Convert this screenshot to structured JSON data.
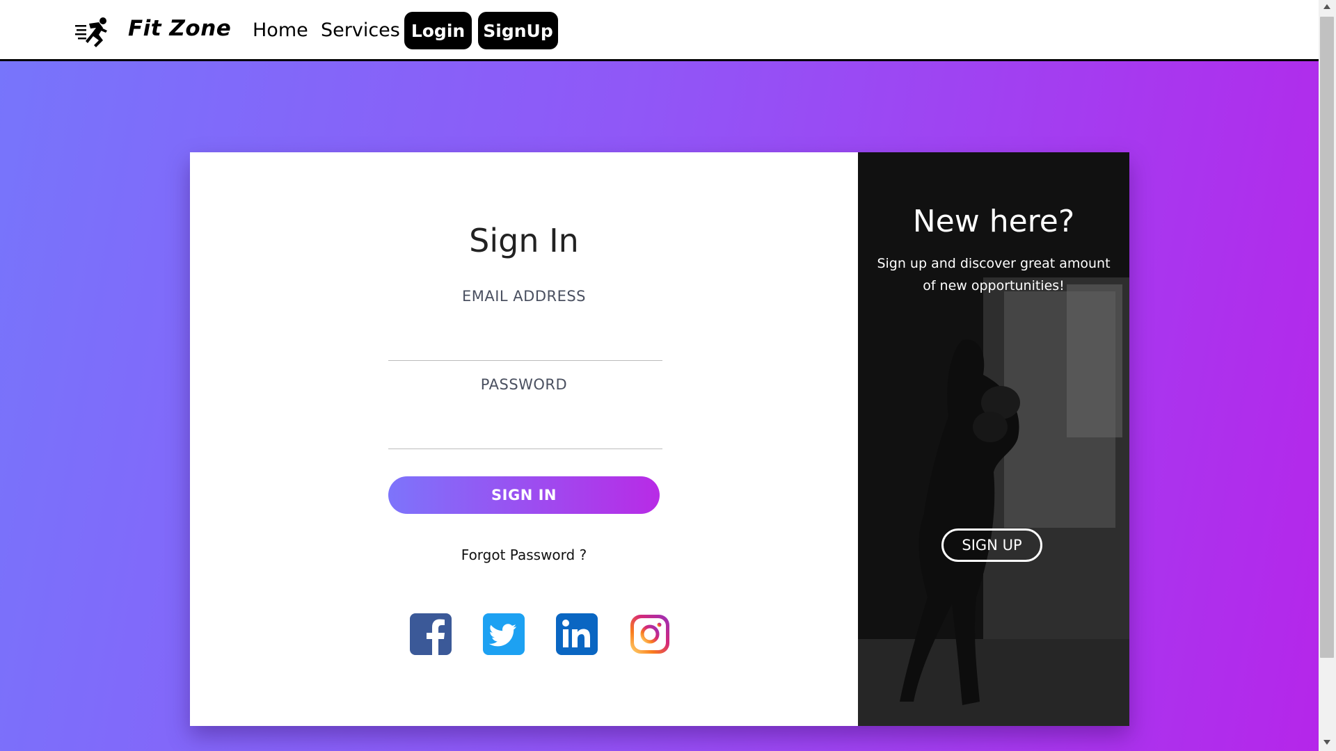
{
  "nav": {
    "brand": "Fit Zone",
    "logo_icon": "running-man-icon",
    "home": "Home",
    "services": "Services",
    "login": "Login",
    "signup": "SignUp"
  },
  "form": {
    "title": "Sign In",
    "email_label": "EMAIL ADDRESS",
    "email_value": "",
    "password_label": "PASSWORD",
    "password_value": "",
    "submit": "SIGN IN",
    "forgot": "Forgot Password ?",
    "socials": [
      "facebook-icon",
      "twitter-icon",
      "linkedin-icon",
      "instagram-icon"
    ]
  },
  "promo": {
    "title": "New here?",
    "text": "Sign up and discover great amount of new opportunities!",
    "button": "SIGN UP"
  },
  "colors": {
    "gradient_start": "#7775fb",
    "gradient_end": "#b526ea",
    "nav_button": "#000000",
    "facebook": "#3b5998",
    "twitter": "#1da1f2",
    "linkedin": "#0a66c2"
  }
}
